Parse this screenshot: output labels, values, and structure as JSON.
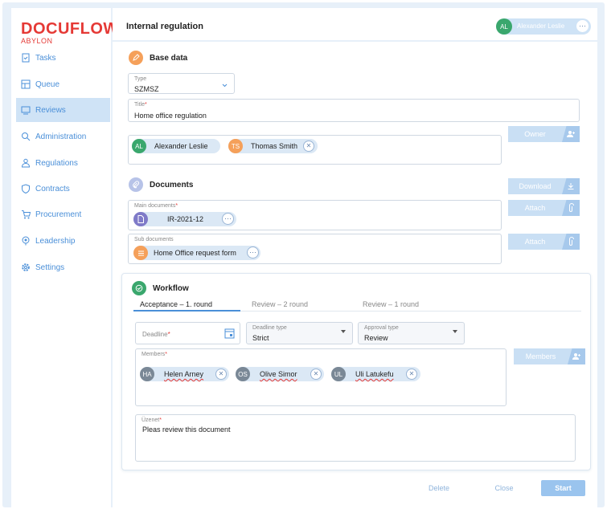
{
  "app": {
    "logo": "DOCUFLOW",
    "logo_sub": "ABYLON",
    "page_title": "Internal regulation"
  },
  "user": {
    "initials": "AL",
    "name": "Alexander Leslie"
  },
  "sidebar": {
    "items": [
      {
        "label": "Tasks",
        "icon": "task-icon"
      },
      {
        "label": "Queue",
        "icon": "queue-icon"
      },
      {
        "label": "Reviews",
        "icon": "reviews-icon",
        "active": true
      },
      {
        "label": "Administration",
        "icon": "administration-icon"
      },
      {
        "label": "Regulations",
        "icon": "regulations-icon"
      },
      {
        "label": "Contracts",
        "icon": "shield-icon"
      },
      {
        "label": "Procurement",
        "icon": "cart-icon"
      },
      {
        "label": "Leadership",
        "icon": "leadership-icon"
      },
      {
        "label": "Settings",
        "icon": "gear-icon"
      }
    ]
  },
  "base": {
    "title": "Base data",
    "type_label": "Type",
    "type_value": "SZMSZ",
    "title_label": "Title",
    "title_value": "Home office regulation",
    "owners": [
      {
        "initials": "AL",
        "name": "Alexander Leslie",
        "color": "#3aa76d"
      },
      {
        "initials": "TS",
        "name": "Thomas Smith",
        "color": "#f5a05a"
      }
    ],
    "owner_button": "Owner"
  },
  "documents": {
    "title": "Documents",
    "download_button": "Download",
    "attach_button": "Attach",
    "main_label": "Main documents",
    "main_value": "IR-2021-12",
    "sub_label": "Sub documents",
    "sub_value": "Home Office request form"
  },
  "workflow": {
    "title": "Workflow",
    "tabs": [
      "Acceptance – 1. round",
      "Review – 2 round",
      "Review – 1 round"
    ],
    "deadline_label": "Deadline",
    "deadline_type_label": "Deadline type",
    "deadline_type_value": "Strict",
    "approval_type_label": "Approval type",
    "approval_type_value": "Review",
    "members_label": "Members",
    "members_button": "Members",
    "members": [
      {
        "initials": "HA",
        "name": "Helen Arney"
      },
      {
        "initials": "OS",
        "name": "Olive Simor"
      },
      {
        "initials": "UL",
        "name": "Uli Latukefu"
      }
    ],
    "message_label": "Üzenet",
    "message_value": "Pleas review this document"
  },
  "footer": {
    "delete": "Delete",
    "close": "Close",
    "start": "Start"
  },
  "colors": {
    "accent": "#4a8fd8",
    "brand": "#e53935",
    "active_bg": "#cfe3f6",
    "page_bg": "#e7f0f9"
  }
}
